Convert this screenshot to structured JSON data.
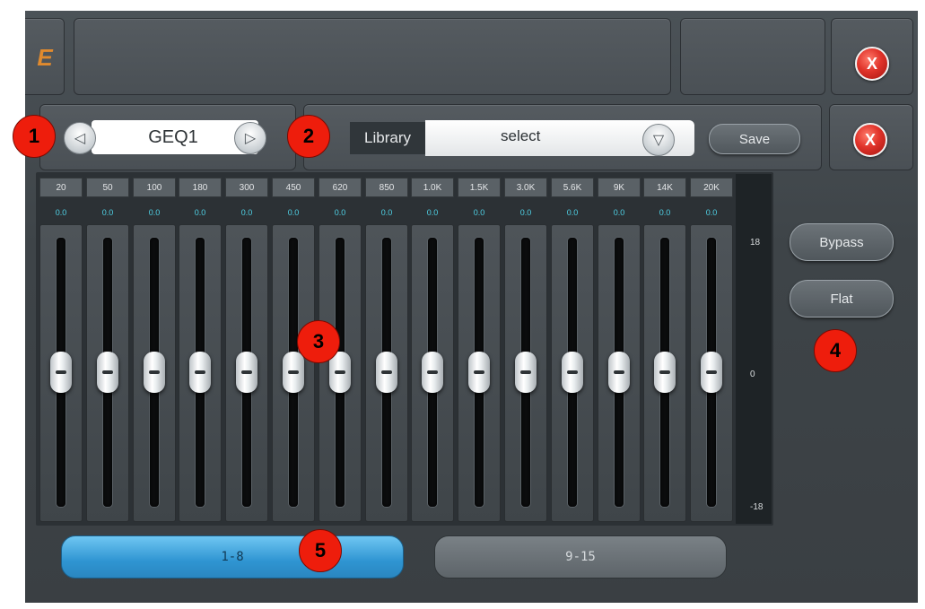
{
  "header": {
    "logo_fragment": "E",
    "close_label": "X"
  },
  "preset": {
    "prev_icon": "◁",
    "name": "GEQ1",
    "next_icon": "▷"
  },
  "library": {
    "label": "Library",
    "value": "select",
    "dropdown_icon": "▽",
    "save_label": "Save",
    "close_label": "X"
  },
  "eq": {
    "bands": [
      {
        "freq": "20",
        "gain": "0.0"
      },
      {
        "freq": "50",
        "gain": "0.0"
      },
      {
        "freq": "100",
        "gain": "0.0"
      },
      {
        "freq": "180",
        "gain": "0.0"
      },
      {
        "freq": "300",
        "gain": "0.0"
      },
      {
        "freq": "450",
        "gain": "0.0"
      },
      {
        "freq": "620",
        "gain": "0.0"
      },
      {
        "freq": "850",
        "gain": "0.0"
      },
      {
        "freq": "1.0K",
        "gain": "0.0"
      },
      {
        "freq": "1.5K",
        "gain": "0.0"
      },
      {
        "freq": "3.0K",
        "gain": "0.0"
      },
      {
        "freq": "5.6K",
        "gain": "0.0"
      },
      {
        "freq": "9K",
        "gain": "0.0"
      },
      {
        "freq": "14K",
        "gain": "0.0"
      },
      {
        "freq": "20K",
        "gain": "0.0"
      }
    ],
    "scale": {
      "top": "18",
      "mid": "0",
      "bottom": "-18"
    },
    "fader_level_fraction": 0.5
  },
  "side": {
    "bypass_label": "Bypass",
    "flat_label": "Flat"
  },
  "pages": {
    "page1_label": "1-8",
    "page2_label": "9-15",
    "active": "1-8"
  },
  "markers": [
    "1",
    "2",
    "3",
    "4",
    "5"
  ],
  "colors": {
    "accent_blue": "#3aa6e0",
    "gain_text": "#4fd3e8",
    "close_red": "#e0332a",
    "marker_red": "#ee1d0c"
  }
}
